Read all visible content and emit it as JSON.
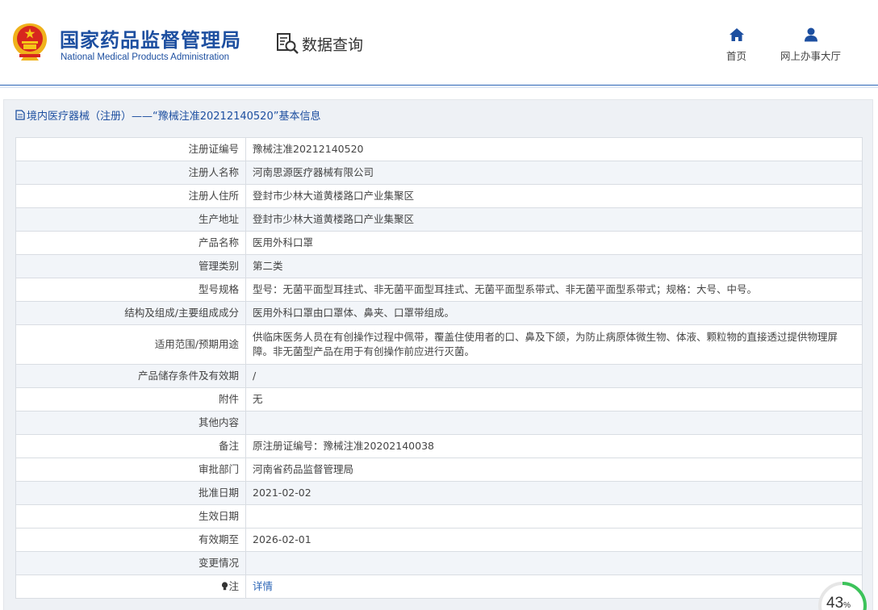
{
  "header": {
    "org_name_cn": "国家药品监督管理局",
    "org_name_en": "National Medical Products Administration",
    "section_title": "数据查询",
    "nav": [
      {
        "label": "首页",
        "icon": "home-icon"
      },
      {
        "label": "网上办事大厅",
        "icon": "user-icon"
      }
    ]
  },
  "panel": {
    "title": "境内医疗器械（注册）——“豫械注准20212140520”基本信息"
  },
  "rows": [
    {
      "key": "注册证编号",
      "value": "豫械注准20212140520"
    },
    {
      "key": "注册人名称",
      "value": "河南思源医疗器械有限公司"
    },
    {
      "key": "注册人住所",
      "value": "登封市少林大道黄楼路口产业集聚区"
    },
    {
      "key": "生产地址",
      "value": "登封市少林大道黄楼路口产业集聚区"
    },
    {
      "key": "产品名称",
      "value": "医用外科口罩"
    },
    {
      "key": "管理类别",
      "value": "第二类"
    },
    {
      "key": "型号规格",
      "value": "型号：无菌平面型耳挂式、非无菌平面型耳挂式、无菌平面型系带式、非无菌平面型系带式；规格：大号、中号。"
    },
    {
      "key": "结构及组成/主要组成成分",
      "value": "医用外科口罩由口罩体、鼻夹、口罩带组成。"
    },
    {
      "key": "适用范围/预期用途",
      "value": "供临床医务人员在有创操作过程中佩带，覆盖住使用者的口、鼻及下颌，为防止病原体微生物、体液、颗粒物的直接透过提供物理屏障。非无菌型产品在用于有创操作前应进行灭菌。"
    },
    {
      "key": "产品储存条件及有效期",
      "value": "/"
    },
    {
      "key": "附件",
      "value": "无"
    },
    {
      "key": "其他内容",
      "value": ""
    },
    {
      "key": "备注",
      "value": "原注册证编号：豫械注准20202140038"
    },
    {
      "key": "审批部门",
      "value": "河南省药品监督管理局"
    },
    {
      "key": "批准日期",
      "value": "2021-02-02"
    },
    {
      "key": "生效日期",
      "value": ""
    },
    {
      "key": "有效期至",
      "value": "2026-02-01"
    },
    {
      "key": "变更情况",
      "value": ""
    },
    {
      "key": "注",
      "value": "详情"
    }
  ],
  "progress": {
    "value": "43",
    "unit": "%",
    "fraction": 0.43,
    "color": "#3cc35a"
  },
  "colors": {
    "brand_blue": "#1d4fa0",
    "link_blue": "#2a64b6",
    "emblem_red": "#d7261e",
    "emblem_gold": "#f5c518"
  }
}
